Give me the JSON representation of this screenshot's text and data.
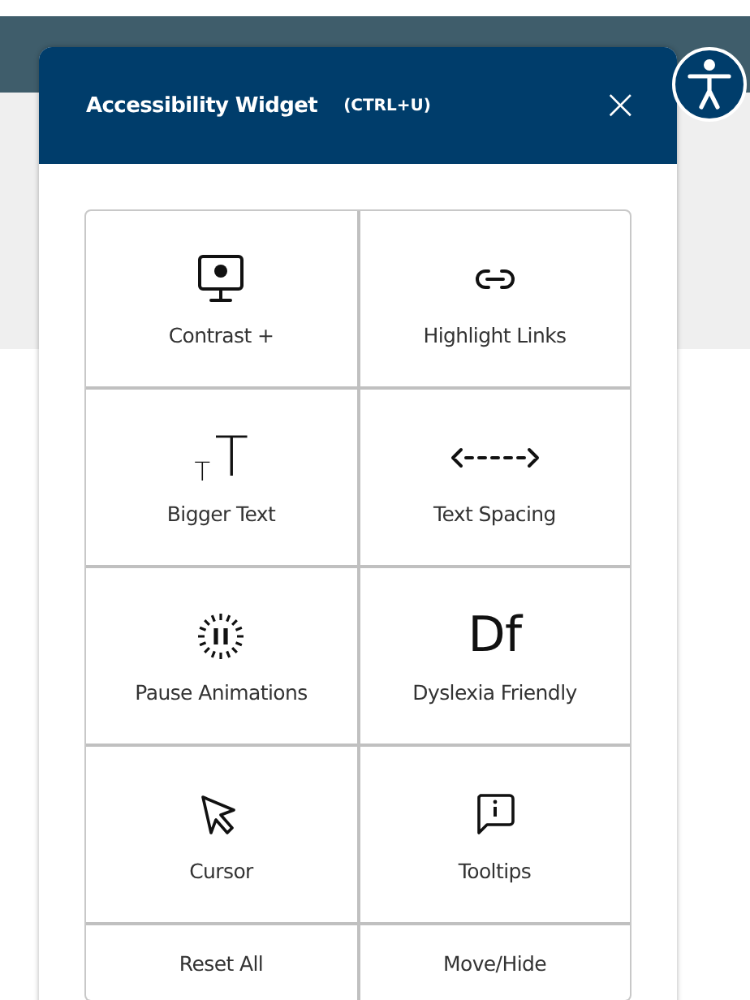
{
  "widget": {
    "title": "Accessibility Widget",
    "shortcut": "(CTRL+U)",
    "close": "×"
  },
  "tool_rows": [
    {
      "cells": [
        {
          "kind": "contrast",
          "label": "Contrast +"
        },
        {
          "kind": "links",
          "label": "Highlight Links"
        }
      ]
    },
    {
      "cells": [
        {
          "kind": "bigger",
          "label": "Bigger Text",
          "glyph": [
            "T",
            "T"
          ]
        },
        {
          "kind": "spacing",
          "label": "Text Spacing"
        }
      ]
    },
    {
      "cells": [
        {
          "kind": "pause",
          "label": "Pause Animations"
        },
        {
          "kind": "dyslexia",
          "label": "Dyslexia Friendly",
          "glyph": [
            "Df"
          ]
        }
      ]
    },
    {
      "cells": [
        {
          "kind": "cursor",
          "label": "Cursor"
        },
        {
          "kind": "tooltips",
          "label": "Tooltips"
        }
      ]
    }
  ],
  "footer_buttons": [
    "Reset All",
    "Move/Hide"
  ]
}
